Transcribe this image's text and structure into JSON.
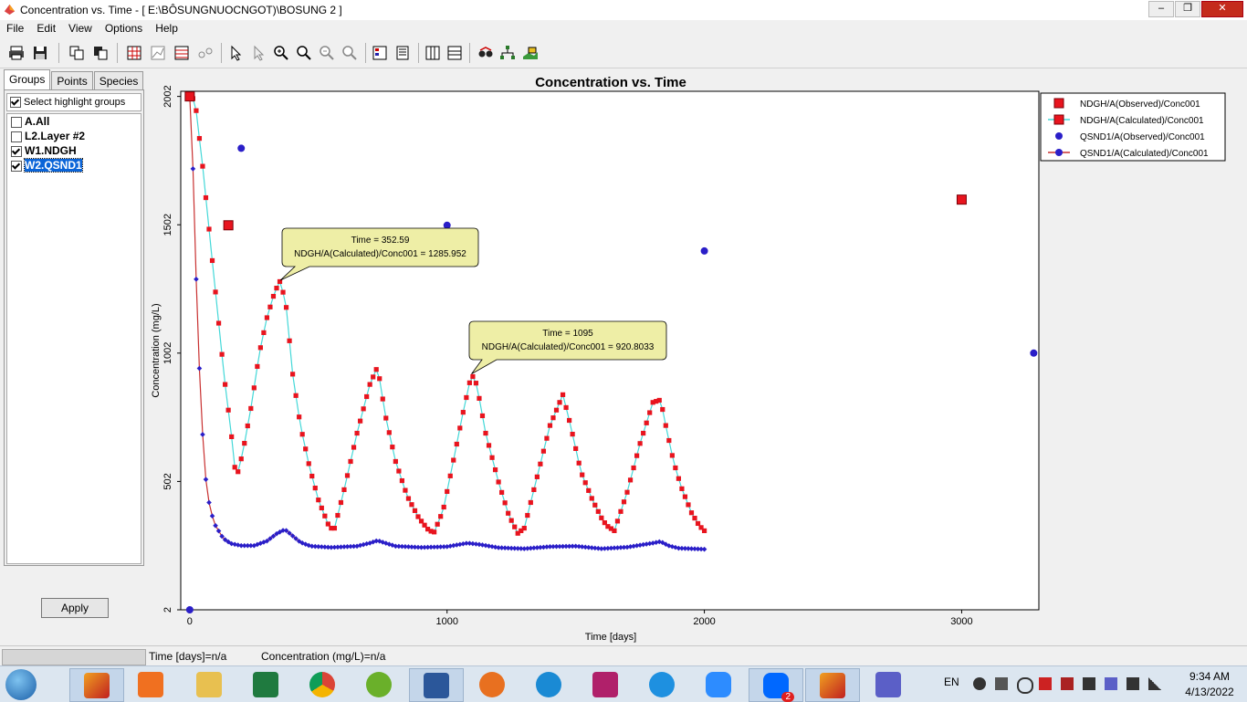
{
  "window": {
    "title": "Concentration vs. Time - [ E:\\BÔSUNGNUOCNGOT)\\BOSUNG 2 ]",
    "minimize": "–",
    "maximize": "❐",
    "close": "✕"
  },
  "menu": [
    "File",
    "Edit",
    "View",
    "Options",
    "Help"
  ],
  "toolbar_icons": [
    "print-icon",
    "save-icon",
    "copy-icon",
    "copy-data-icon",
    "grid-icon",
    "chart-icon",
    "table-icon",
    "series-icon",
    "pointer-icon",
    "select-icon",
    "zoom-in-icon",
    "zoom-all-icon",
    "zoom-out-icon",
    "zoom-reset-icon",
    "legend-icon",
    "properties-icon",
    "columns-icon",
    "rows-icon",
    "view-icon",
    "tree-icon",
    "map-icon"
  ],
  "left_panel": {
    "tabs": [
      "Groups",
      "Points",
      "Species"
    ],
    "active_tab": "Groups",
    "select_highlight": {
      "label": "Select highlight groups",
      "checked": true
    },
    "groups": [
      {
        "label": "A.All",
        "checked": false
      },
      {
        "label": "L2.Layer #2",
        "checked": false
      },
      {
        "label": "W1.NDGH",
        "checked": true
      },
      {
        "label": "W2.QSND1",
        "checked": true
      }
    ],
    "apply_label": "Apply"
  },
  "status": {
    "time": "Time  [days]=n/a",
    "conc": "Concentration (mg/L)=n/a"
  },
  "taskbar": {
    "lang": "EN",
    "time": "9:34 AM",
    "date": "4/13/2022",
    "zalo_badge": "2"
  },
  "chart_data": {
    "type": "scatter",
    "title": "Concentration vs. Time",
    "xlabel": "Time  [days]",
    "ylabel": "Concentration (mg/L)",
    "xlim": [
      -35,
      3300
    ],
    "ylim": [
      2,
      2022
    ],
    "xticks": [
      0,
      1000,
      2000,
      3000
    ],
    "yticks": [
      2,
      502,
      1002,
      1502,
      2002
    ],
    "grid": false,
    "legend_position": "top-right, outside plot",
    "colors": {
      "ndgh_marker": "#e8141e",
      "ndgh_line": "#44d8d8",
      "qsnd_marker": "#2a1ec8",
      "qsnd_line": "#c83030",
      "callout": "#eeeea6"
    },
    "series": [
      {
        "name": "NDGH/A(Observed)/Conc001",
        "kind": "observed",
        "marker": "square",
        "color": "#e8141e",
        "x": [
          0,
          150,
          3000
        ],
        "y": [
          2002,
          1500,
          1600
        ]
      },
      {
        "name": "NDGH/A(Calculated)/Conc001",
        "kind": "calculated",
        "marker": "small-square",
        "color": "#e8141e",
        "line": "#44d8d8",
        "breakpoints": [
          [
            0,
            2000
          ],
          [
            20,
            1990
          ],
          [
            50,
            1730
          ],
          [
            100,
            1240
          ],
          [
            135,
            900
          ],
          [
            160,
            700
          ],
          [
            180,
            510
          ],
          [
            205,
            610
          ],
          [
            240,
            800
          ],
          [
            270,
            1000
          ],
          [
            300,
            1140
          ],
          [
            330,
            1240
          ],
          [
            352.59,
            1285.952
          ],
          [
            375,
            1180
          ],
          [
            400,
            920
          ],
          [
            430,
            720
          ],
          [
            465,
            560
          ],
          [
            500,
            430
          ],
          [
            540,
            330
          ],
          [
            560,
            310
          ],
          [
            600,
            470
          ],
          [
            650,
            690
          ],
          [
            700,
            880
          ],
          [
            730,
            950
          ],
          [
            760,
            760
          ],
          [
            800,
            580
          ],
          [
            845,
            445
          ],
          [
            890,
            360
          ],
          [
            930,
            310
          ],
          [
            950,
            305
          ],
          [
            985,
            390
          ],
          [
            1020,
            560
          ],
          [
            1060,
            760
          ],
          [
            1095,
            920.8033
          ],
          [
            1115,
            880
          ],
          [
            1150,
            690
          ],
          [
            1200,
            500
          ],
          [
            1240,
            370
          ],
          [
            1275,
            300
          ],
          [
            1300,
            320
          ],
          [
            1350,
            520
          ],
          [
            1400,
            720
          ],
          [
            1450,
            840
          ],
          [
            1480,
            720
          ],
          [
            1520,
            540
          ],
          [
            1565,
            430
          ],
          [
            1600,
            360
          ],
          [
            1620,
            330
          ],
          [
            1650,
            310
          ],
          [
            1700,
            460
          ],
          [
            1750,
            650
          ],
          [
            1800,
            810
          ],
          [
            1830,
            820
          ],
          [
            1850,
            720
          ],
          [
            1880,
            580
          ],
          [
            1910,
            480
          ],
          [
            1950,
            380
          ],
          [
            1980,
            330
          ],
          [
            2000,
            310
          ]
        ],
        "sample_step": 12.5
      },
      {
        "name": "QSND1/A(Observed)/Conc001",
        "kind": "observed",
        "marker": "circle",
        "color": "#2a1ec8",
        "x": [
          0,
          200,
          1000,
          2000,
          3280
        ],
        "y": [
          2,
          1800,
          1500,
          1400,
          1002
        ]
      },
      {
        "name": "QSND1/A(Calculated)/Conc001",
        "kind": "calculated",
        "marker": "small-diamond",
        "color": "#2a1ec8",
        "line": "#c83030",
        "breakpoints": [
          [
            0,
            2000
          ],
          [
            5,
            1960
          ],
          [
            15,
            1640
          ],
          [
            25,
            1290
          ],
          [
            35,
            1000
          ],
          [
            45,
            770
          ],
          [
            55,
            600
          ],
          [
            65,
            480
          ],
          [
            80,
            390
          ],
          [
            100,
            330
          ],
          [
            130,
            280
          ],
          [
            160,
            260
          ],
          [
            200,
            252
          ],
          [
            250,
            252
          ],
          [
            300,
            270
          ],
          [
            340,
            300
          ],
          [
            370,
            315
          ],
          [
            400,
            290
          ],
          [
            430,
            265
          ],
          [
            470,
            250
          ],
          [
            550,
            245
          ],
          [
            650,
            250
          ],
          [
            700,
            262
          ],
          [
            730,
            272
          ],
          [
            760,
            262
          ],
          [
            800,
            250
          ],
          [
            900,
            245
          ],
          [
            1000,
            248
          ],
          [
            1080,
            262
          ],
          [
            1130,
            256
          ],
          [
            1200,
            244
          ],
          [
            1300,
            240
          ],
          [
            1400,
            248
          ],
          [
            1500,
            250
          ],
          [
            1600,
            240
          ],
          [
            1700,
            246
          ],
          [
            1800,
            262
          ],
          [
            1830,
            268
          ],
          [
            1860,
            252
          ],
          [
            1900,
            242
          ],
          [
            2000,
            238
          ]
        ],
        "sample_step": 12.5
      }
    ],
    "annotations": [
      {
        "line1": "Time = 352.59",
        "line2": "NDGH/A(Calculated)/Conc001 = 1285.952",
        "x": 352.59,
        "y": 1285.952
      },
      {
        "line1": "Time = 1095",
        "line2": "NDGH/A(Calculated)/Conc001 = 920.8033",
        "x": 1095,
        "y": 920.8033
      }
    ]
  }
}
